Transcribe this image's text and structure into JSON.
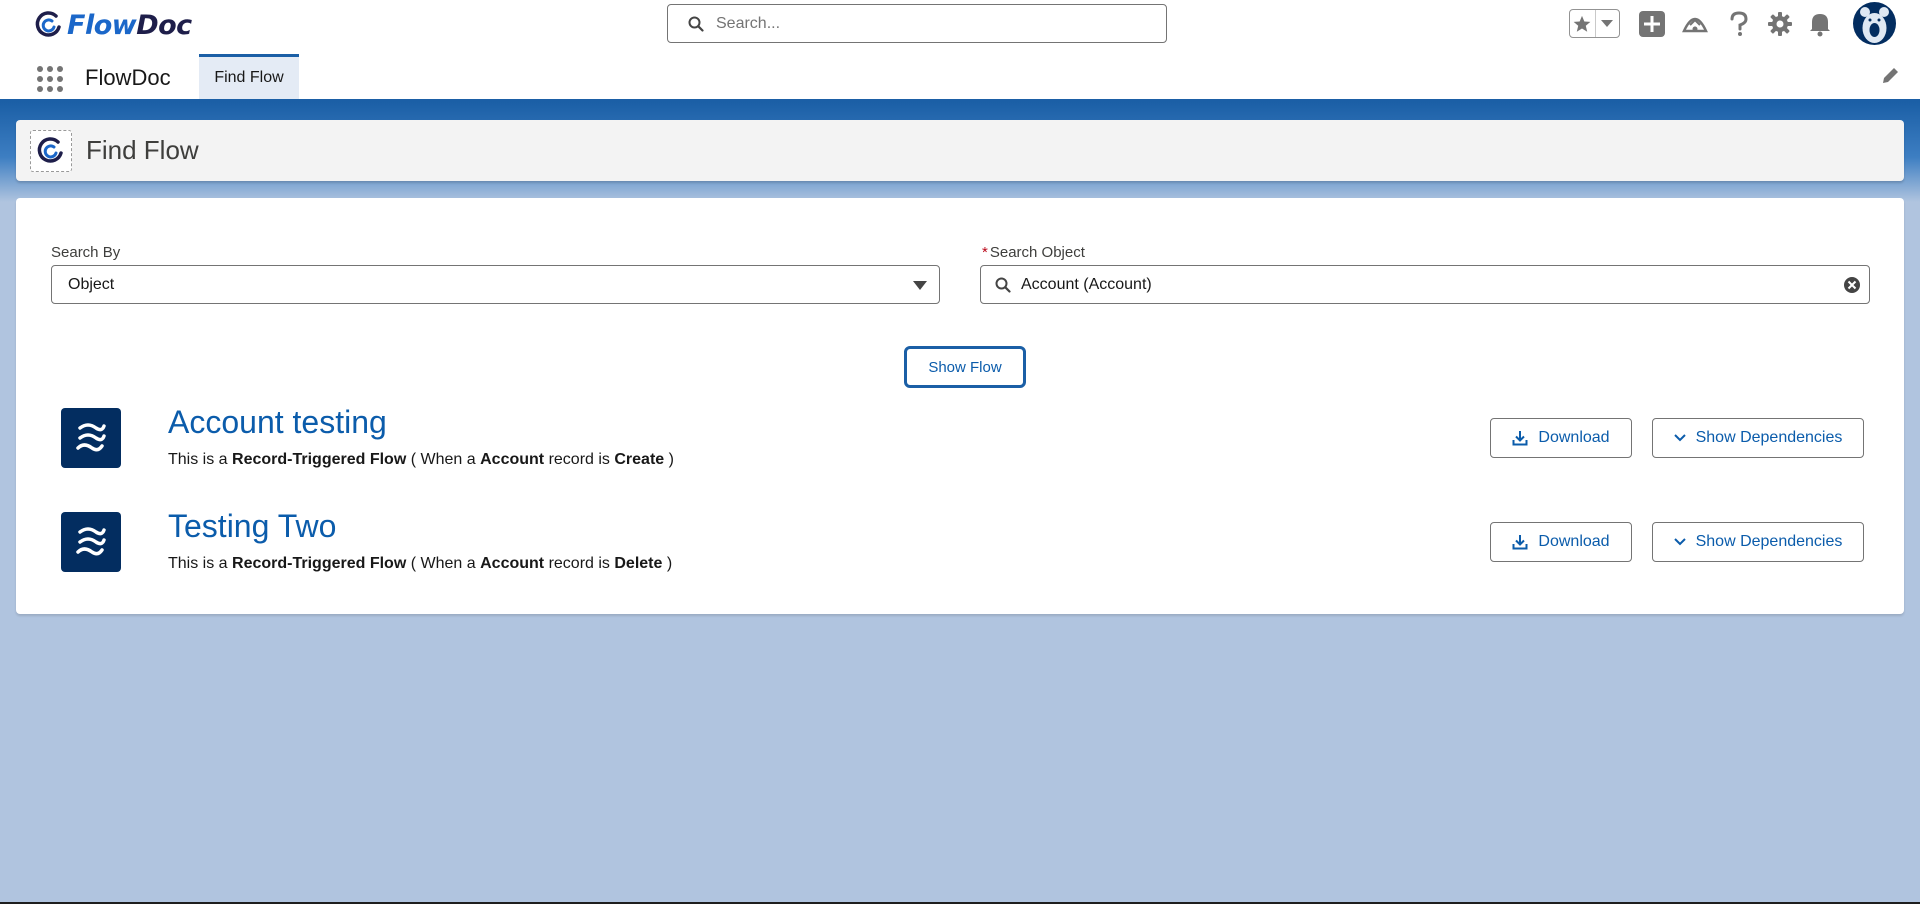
{
  "brand": {
    "logo_part1": "Flow",
    "logo_part2": "Doc"
  },
  "global_search": {
    "placeholder": "Search..."
  },
  "app_nav": {
    "app_name": "FlowDoc",
    "tab_label": "Find Flow"
  },
  "page_header": {
    "title": "Find Flow"
  },
  "form": {
    "search_by_label": "Search By",
    "search_by_value": "Object",
    "search_object_label": "Search Object",
    "required_mark": "*",
    "search_object_value": "Account (Account)",
    "show_flow_label": "Show Flow"
  },
  "flows": [
    {
      "title": "Account testing",
      "desc_prefix": "This is a",
      "flow_type": "Record-Triggered Flow",
      "desc_mid": "( When a",
      "object": "Account",
      "desc_mid2": "record is",
      "trigger": "Create",
      "desc_end": ")",
      "download_label": "Download",
      "deps_label": "Show Dependencies"
    },
    {
      "title": "Testing Two",
      "desc_prefix": "This is a",
      "flow_type": "Record-Triggered Flow",
      "desc_mid": "( When a",
      "object": "Account",
      "desc_mid2": "record is",
      "trigger": "Delete",
      "desc_end": ")",
      "download_label": "Download",
      "deps_label": "Show Dependencies"
    }
  ],
  "colors": {
    "brand_blue": "#1b5fa6",
    "link_blue": "#0b5cab",
    "navy": "#032d60",
    "background": "#b0c4df"
  }
}
